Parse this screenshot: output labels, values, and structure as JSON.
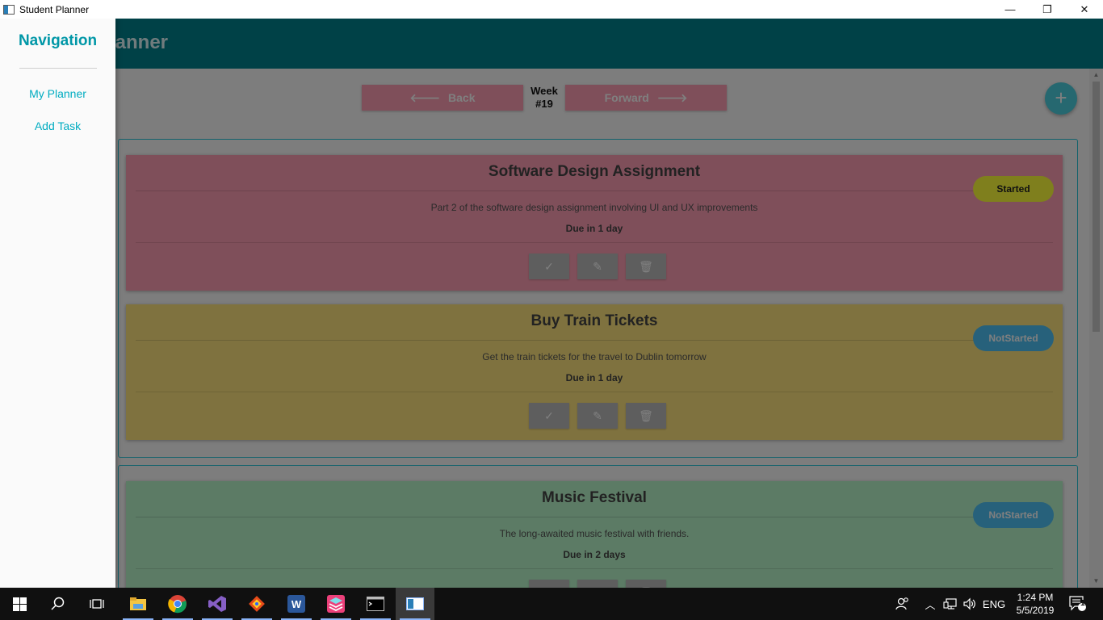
{
  "window": {
    "title": "Student Planner",
    "controls": {
      "minimize": "—",
      "restore": "❐",
      "close": "✕"
    }
  },
  "appbar": {
    "title": "Student Planner"
  },
  "week_nav": {
    "back_label": "Back",
    "forward_label": "Forward",
    "week_label": "Week",
    "week_number": "#19",
    "button_color": "#ff9eb5"
  },
  "add_button": {
    "icon": "plus-icon",
    "symbol": "+"
  },
  "tasks": [
    {
      "title": "Software Design Assignment",
      "description": "Part 2 of the software design assignment involving UI and UX improvements",
      "due": "Due in 1 day",
      "status": "Started",
      "card_color": "#ff9eb5",
      "status_color": "#ffff3b"
    },
    {
      "title": "Buy Train Tickets",
      "description": "Get the train tickets for the travel to Dublin tomorrow",
      "due": "Due in 1 day",
      "status": "NotStarted",
      "card_color": "#ffe57f",
      "status_color": "#4fc3f7"
    },
    {
      "title": "Music Festival",
      "description": "The long-awaited music festival with friends.",
      "due": "Due in 2 days",
      "status": "NotStarted",
      "card_color": "#b9f6ca",
      "status_color": "#4fc3f7"
    }
  ],
  "card_actions": [
    {
      "name": "complete",
      "icon": "check-icon",
      "symbol": "✓"
    },
    {
      "name": "edit",
      "icon": "pencil-icon",
      "symbol": "✎"
    },
    {
      "name": "delete",
      "icon": "trash-icon",
      "symbol": "🗑"
    }
  ],
  "navigation": {
    "title": "Navigation",
    "items": [
      {
        "label": "My Planner"
      },
      {
        "label": "Add Task"
      }
    ]
  },
  "taskbar": {
    "apps": [
      {
        "name": "start",
        "icon": "windows-icon"
      },
      {
        "name": "search",
        "icon": "search-icon"
      },
      {
        "name": "task-view",
        "icon": "task-view-icon"
      },
      {
        "name": "file-explorer",
        "icon": "folder-icon"
      },
      {
        "name": "chrome",
        "icon": "chrome-icon"
      },
      {
        "name": "visual-studio",
        "icon": "visual-studio-icon"
      },
      {
        "name": "git",
        "icon": "git-icon"
      },
      {
        "name": "word",
        "icon": "word-icon",
        "letter": "W"
      },
      {
        "name": "stack-app",
        "icon": "stack-icon"
      },
      {
        "name": "terminal",
        "icon": "terminal-icon"
      },
      {
        "name": "student-planner",
        "icon": "app-window-icon"
      }
    ],
    "tray": {
      "language": "ENG",
      "time": "1:24 PM",
      "date": "5/5/2019",
      "notifications": "1"
    }
  }
}
